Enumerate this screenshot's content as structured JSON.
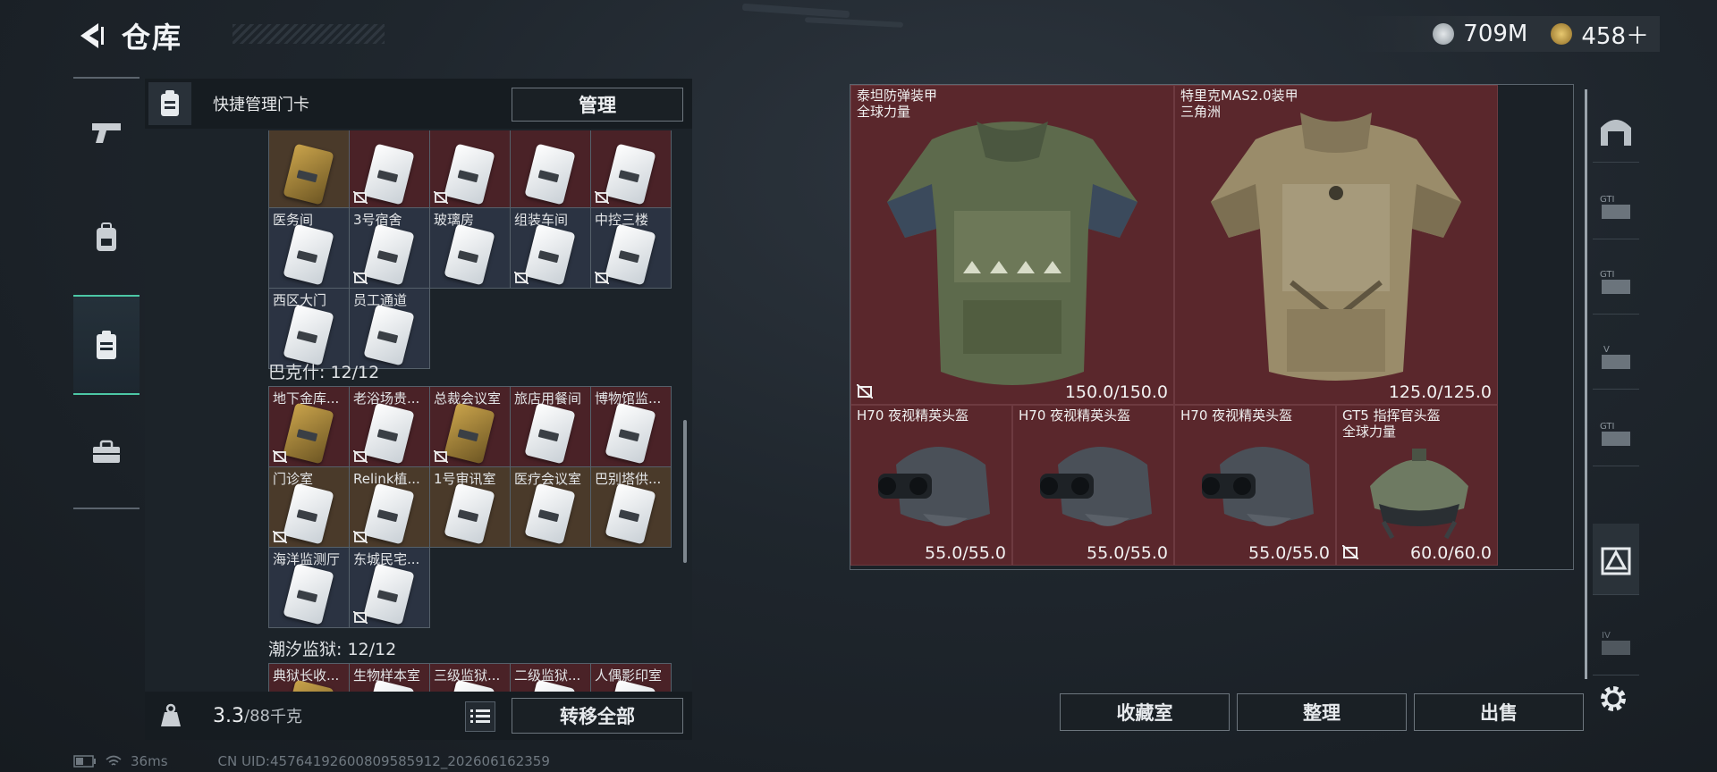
{
  "header": {
    "title": "仓库"
  },
  "currency": [
    {
      "icon": "silver-coin-icon",
      "color": "#b9c0c6",
      "value": "709M"
    },
    {
      "icon": "gold-coin-icon",
      "color": "#c9a24a",
      "value": "458＋"
    }
  ],
  "left_rail": {
    "tabs": [
      {
        "icon": "pistol-icon",
        "active": false
      },
      {
        "icon": "backpack-icon",
        "active": false
      },
      {
        "icon": "keycard-holder-icon",
        "active": true
      },
      {
        "icon": "briefcase-icon",
        "active": false
      }
    ]
  },
  "quick_bar": {
    "label": "快捷管理门卡",
    "manage_label": "管理"
  },
  "sections": [
    {
      "title": "",
      "cards": [
        {
          "name": "",
          "tone": "brown",
          "gold": true,
          "locked": false
        },
        {
          "name": "",
          "tone": "red",
          "gold": false,
          "locked": true
        },
        {
          "name": "",
          "tone": "red",
          "gold": false,
          "locked": true
        },
        {
          "name": "",
          "tone": "red",
          "gold": false,
          "locked": false
        },
        {
          "name": "",
          "tone": "red",
          "gold": false,
          "locked": true
        },
        {
          "name": "医务间",
          "tone": "blue",
          "gold": false,
          "locked": false
        },
        {
          "name": "3号宿舍",
          "tone": "blue",
          "gold": false,
          "locked": true
        },
        {
          "name": "玻璃房",
          "tone": "blue",
          "gold": false,
          "locked": false
        },
        {
          "name": "组装车间",
          "tone": "blue",
          "gold": false,
          "locked": true
        },
        {
          "name": "中控三楼",
          "tone": "blue",
          "gold": false,
          "locked": true
        },
        {
          "name": "西区大门",
          "tone": "blue",
          "gold": false,
          "locked": false
        },
        {
          "name": "员工通道",
          "tone": "blue",
          "gold": false,
          "locked": false
        }
      ]
    },
    {
      "title": "巴克什: 12/12",
      "cards": [
        {
          "name": "地下金库...",
          "tone": "red",
          "gold": true,
          "locked": true
        },
        {
          "name": "老浴场贵...",
          "tone": "red",
          "gold": false,
          "locked": true
        },
        {
          "name": "总裁会议室",
          "tone": "red",
          "gold": true,
          "locked": true
        },
        {
          "name": "旅店用餐间",
          "tone": "red",
          "gold": false,
          "locked": false
        },
        {
          "name": "博物馆监...",
          "tone": "red",
          "gold": false,
          "locked": false
        },
        {
          "name": "门诊室",
          "tone": "brown",
          "gold": false,
          "locked": true
        },
        {
          "name": "Relink植...",
          "tone": "brown",
          "gold": false,
          "locked": true
        },
        {
          "name": "1号审讯室",
          "tone": "brown",
          "gold": false,
          "locked": false
        },
        {
          "name": "医疗会议室",
          "tone": "brown",
          "gold": false,
          "locked": false
        },
        {
          "name": "巴别塔供...",
          "tone": "brown",
          "gold": false,
          "locked": false
        },
        {
          "name": "海洋监测厅",
          "tone": "blue",
          "gold": false,
          "locked": false
        },
        {
          "name": "东城民宅...",
          "tone": "blue",
          "gold": false,
          "locked": true
        }
      ]
    },
    {
      "title": "潮汐监狱: 12/12",
      "cards": [
        {
          "name": "典狱长收...",
          "tone": "red",
          "gold": true,
          "locked": false
        },
        {
          "name": "生物样本室",
          "tone": "red",
          "gold": false,
          "locked": false
        },
        {
          "name": "三级监狱...",
          "tone": "red",
          "gold": false,
          "locked": false
        },
        {
          "name": "二级监狱...",
          "tone": "red",
          "gold": false,
          "locked": false
        },
        {
          "name": "人偶影印室",
          "tone": "red",
          "gold": false,
          "locked": false
        }
      ]
    }
  ],
  "footer": {
    "weight_current": "3.3",
    "weight_sep": "/",
    "weight_max": "88",
    "weight_unit": "千克",
    "transfer_label": "转移全部"
  },
  "stash_items": [
    {
      "name_lines": [
        "泰坦防弹装甲",
        "全球力量"
      ],
      "durability": "150.0/150.0",
      "kind": "armor-green",
      "locked": true
    },
    {
      "name_lines": [
        "特里克MAS2.0装甲",
        "三角洲"
      ],
      "durability": "125.0/125.0",
      "kind": "armor-camo",
      "locked": false
    },
    {
      "name_lines": [
        "H70 夜视精英头盔"
      ],
      "durability": "55.0/55.0",
      "kind": "helmet-nvg",
      "locked": false
    },
    {
      "name_lines": [
        "H70 夜视精英头盔"
      ],
      "durability": "55.0/55.0",
      "kind": "helmet-nvg",
      "locked": false
    },
    {
      "name_lines": [
        "H70 夜视精英头盔"
      ],
      "durability": "55.0/55.0",
      "kind": "helmet-nvg",
      "locked": false
    },
    {
      "name_lines": [
        "GT5 指挥官头盔",
        "全球力量"
      ],
      "durability": "60.0/60.0",
      "kind": "helmet-green",
      "locked": true
    }
  ],
  "right_rail": {
    "tabs": [
      {
        "icon": "stash-home-icon",
        "label": "",
        "active": false
      },
      {
        "icon": "expansion-case-1-icon",
        "label": "GTI",
        "active": false
      },
      {
        "icon": "expansion-case-2-icon",
        "label": "GTI",
        "active": false
      },
      {
        "icon": "expansion-case-3-icon",
        "label": "V",
        "active": false
      },
      {
        "icon": "expansion-case-4-icon",
        "label": "GTI",
        "active": false
      },
      {
        "icon": "armor-case-icon",
        "label": "",
        "active": true
      },
      {
        "icon": "expansion-case-5-icon",
        "label": "IV",
        "active": false
      }
    ]
  },
  "bottom_buttons": [
    {
      "label": "收藏室"
    },
    {
      "label": "整理"
    },
    {
      "label": "出售"
    }
  ],
  "status": {
    "ping": "36ms",
    "uid": "CN UID:457641926008095859​12_202606162359"
  }
}
